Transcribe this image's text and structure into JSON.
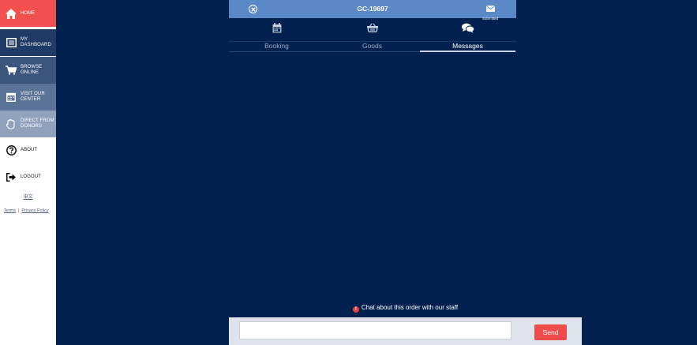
{
  "sidebar": {
    "items": [
      {
        "label": "HOME",
        "icon": "home-icon"
      },
      {
        "label": "MY DASHBOARD",
        "icon": "dashboard-icon"
      },
      {
        "label": "BROWSE ONLINE",
        "icon": "cart-icon"
      },
      {
        "label": "VISIT OUR CENTER",
        "icon": "calendar-icon"
      },
      {
        "label": "DIRECT FROM DONORS",
        "icon": "hand-icon"
      },
      {
        "label": "ABOUT",
        "icon": "question-icon"
      },
      {
        "label": "LOGOUT",
        "icon": "logout-icon"
      }
    ],
    "language": "中文",
    "terms": "Terms",
    "separator": "|",
    "privacy": "Privacy Policy"
  },
  "header": {
    "order_code": "GC-19697",
    "status_label": "Submitted"
  },
  "tabs": [
    {
      "label": "Booking",
      "icon": "calendar-icon",
      "active": false
    },
    {
      "label": "Goods",
      "icon": "basket-icon",
      "active": false
    },
    {
      "label": "Messages",
      "icon": "chat-icon",
      "active": true
    }
  ],
  "chat": {
    "info": "Chat about this order with our staff",
    "input_placeholder": "",
    "send_label": "Send"
  },
  "colors": {
    "background": "#02214f",
    "accent_red": "#f2504f",
    "header_blue": "#5b88c6"
  }
}
